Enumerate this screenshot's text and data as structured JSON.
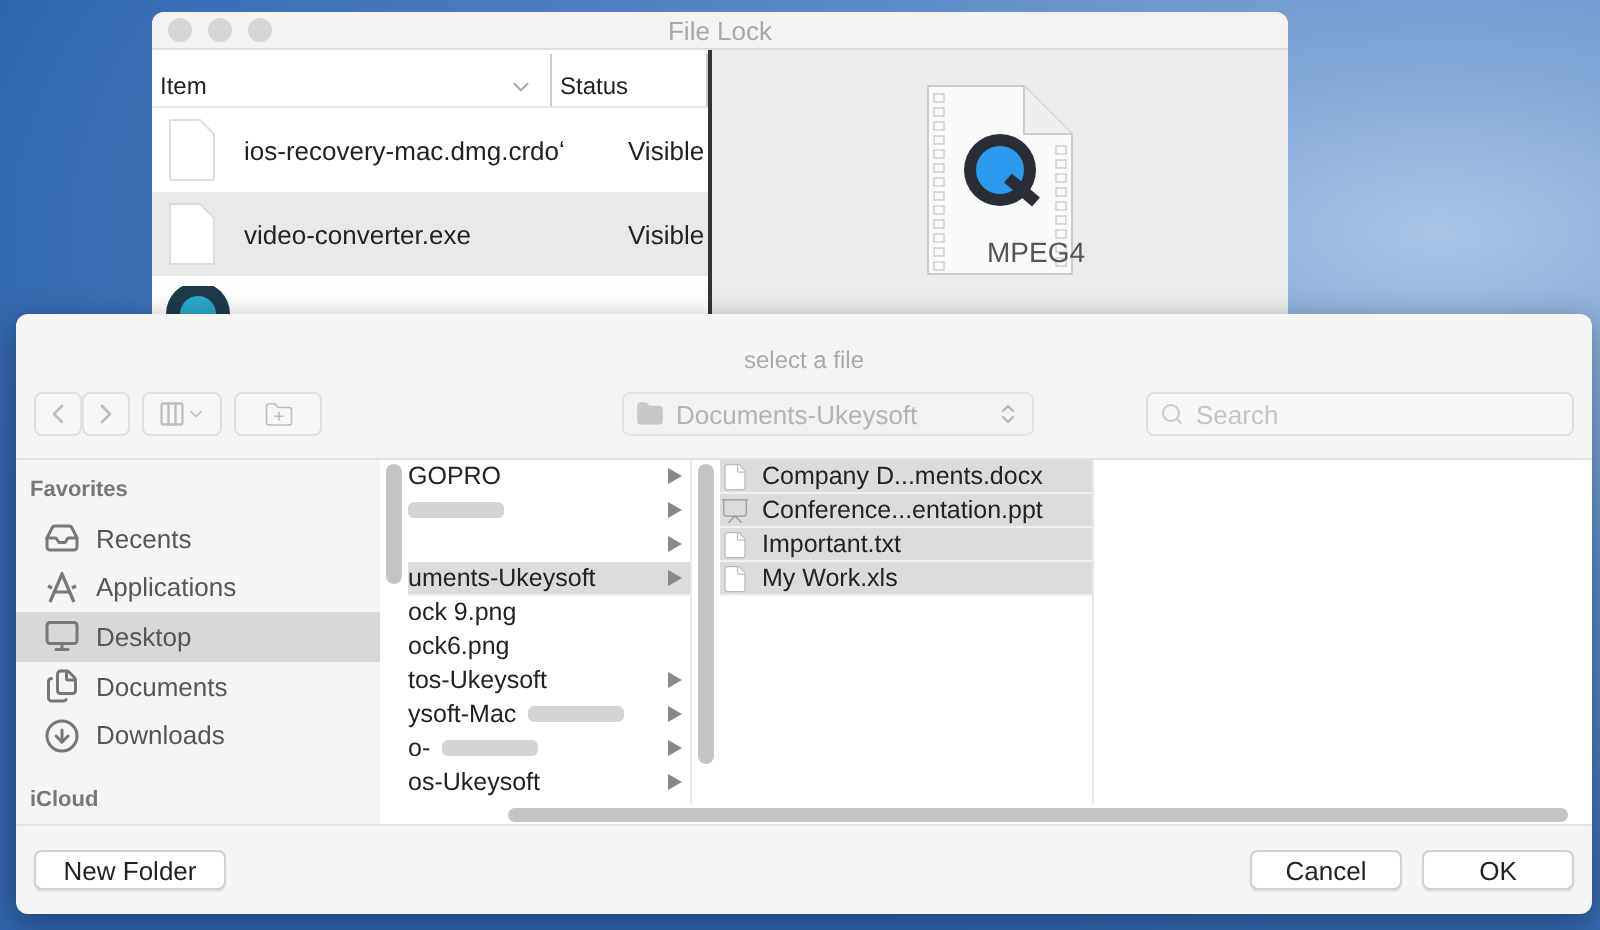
{
  "back_window": {
    "title": "File Lock",
    "table": {
      "columns": [
        "Item",
        "Status"
      ],
      "rows": [
        {
          "kind": "file",
          "name": "ios-recovery-mac.dmg.crdoʻ",
          "status": "Visible",
          "selected": false
        },
        {
          "kind": "file",
          "name": "video-converter.exe",
          "status": "Visible",
          "selected": true
        },
        {
          "kind": "app"
        }
      ]
    },
    "preview": {
      "label": "MPEG4"
    }
  },
  "dialog": {
    "title": "select a file",
    "path": "Documents-Ukeysoft",
    "search": {
      "placeholder": "Search"
    },
    "sidebar": [
      {
        "heading": "Favorites",
        "items": [
          {
            "kind": "recents",
            "label": "Recents",
            "selected": false
          },
          {
            "kind": "applications",
            "label": "Applications",
            "selected": false
          },
          {
            "kind": "desktop",
            "label": "Desktop",
            "selected": true
          },
          {
            "kind": "documents",
            "label": "Documents",
            "selected": false
          },
          {
            "kind": "downloads",
            "label": "Downloads",
            "selected": false
          }
        ]
      },
      {
        "heading": "iCloud"
      }
    ],
    "columns": [
      [
        {
          "name": "GOPRO",
          "folder": true,
          "selected": false
        },
        {
          "blurred": true,
          "folder": true,
          "selected": false
        },
        {
          "folder": true,
          "selected": false
        },
        {
          "name": "uments-Ukeysoft",
          "folder": true,
          "selected": true
        },
        {
          "name": "ock 9.png",
          "folder": false,
          "selected": false
        },
        {
          "name": "ock6.png",
          "folder": false,
          "selected": false
        },
        {
          "name": "tos-Ukeysoft",
          "folder": true,
          "selected": false
        },
        {
          "name": "ysoft-Mac",
          "blurred": true,
          "folder": true,
          "selected": false
        },
        {
          "name": "o-",
          "blurred": true,
          "folder": true,
          "selected": false
        },
        {
          "name": "os-Ukeysoft",
          "folder": true,
          "selected": false
        }
      ],
      [
        {
          "name": "Company D...ments.docx",
          "kind": "doc",
          "selected": true
        },
        {
          "name": "Conference...entation.ppt",
          "kind": "slides",
          "selected": true
        },
        {
          "name": "Important.txt",
          "kind": "doc",
          "selected": true
        },
        {
          "name": "My Work.xls",
          "kind": "doc",
          "selected": true
        }
      ]
    ],
    "buttons": {
      "new_folder": "New Folder",
      "cancel": "Cancel",
      "ok": "OK"
    }
  }
}
